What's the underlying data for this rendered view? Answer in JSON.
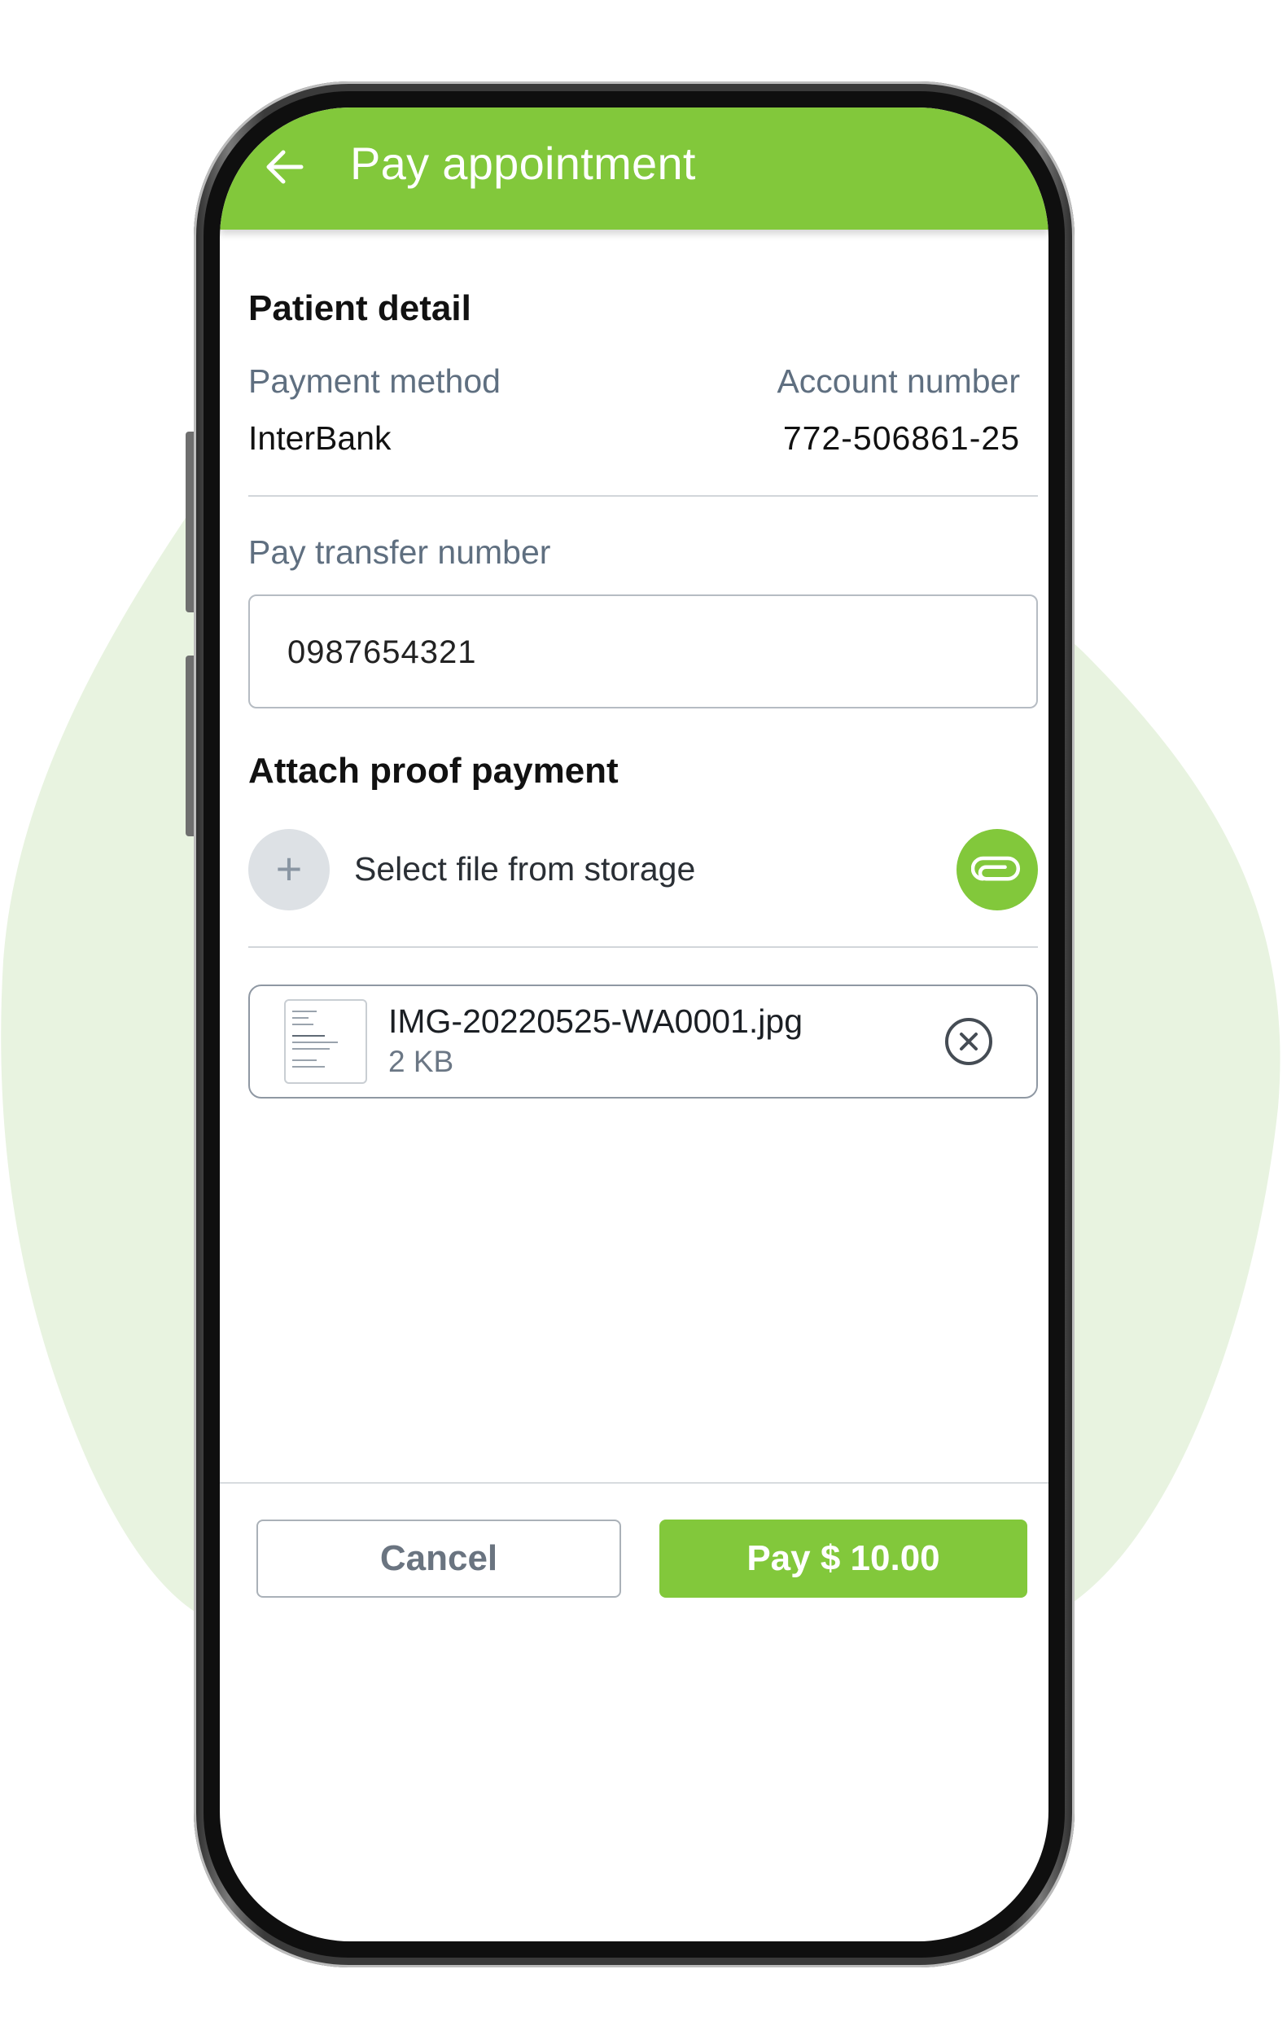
{
  "header": {
    "title": "Pay appointment",
    "back_icon": "arrow-left-icon",
    "background_color": "#82c83b"
  },
  "patient_detail": {
    "section_title": "Patient detail",
    "payment_method_label": "Payment method",
    "payment_method_value": "InterBank",
    "account_number_label": "Account number",
    "account_number_value": "772-506861-25"
  },
  "pay_transfer": {
    "label": "Pay transfer number",
    "value": "0987654321"
  },
  "attach_proof": {
    "section_title": "Attach proof payment",
    "select_file_label": "Select file from storage",
    "plus_icon": "plus-icon",
    "attach_icon": "paperclip-icon"
  },
  "attached_file": {
    "name": "IMG-20220525-WA0001.jpg",
    "size": "2 KB",
    "remove_icon": "close-circle-icon"
  },
  "footer": {
    "cancel_label": "Cancel",
    "pay_label": "Pay $ 10.00"
  },
  "colors": {
    "accent": "#82c83b",
    "background_blob": "#e8f3e0",
    "muted_text": "#5f6f80"
  }
}
